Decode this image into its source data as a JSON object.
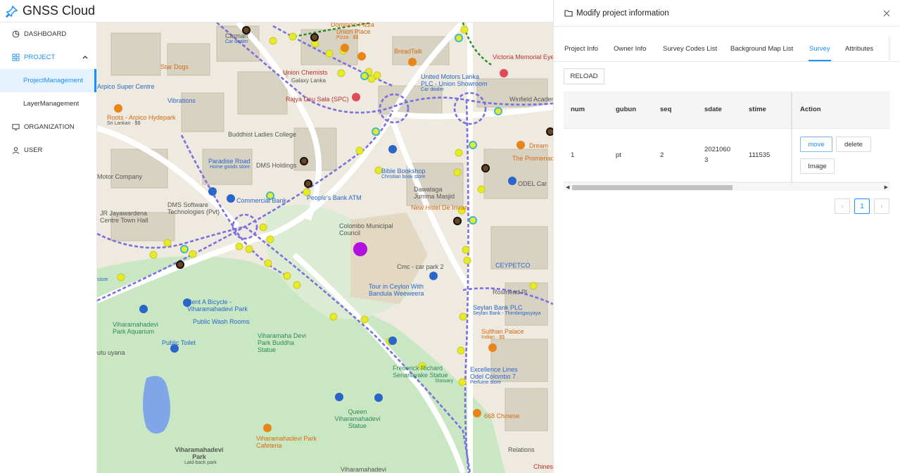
{
  "app": {
    "title": "GNSS Cloud"
  },
  "sidebar": {
    "items": [
      {
        "label": "DASHBOARD",
        "icon": "dashboard-icon"
      },
      {
        "label": "PROJECT",
        "icon": "project-icon"
      },
      {
        "label": "ProjectManagement"
      },
      {
        "label": "LayerManagement"
      },
      {
        "label": "ORGANIZATION",
        "icon": "monitor-icon"
      },
      {
        "label": "USER",
        "icon": "user-icon"
      }
    ]
  },
  "map": {
    "labels": [
      "Carmart",
      "Car dealer",
      "Domino's Pizza",
      "Union Place",
      "Pizza · $$",
      "BreadTalk",
      "Victoria Memorial Eye Hospital",
      "Star Dogs",
      "Union Chemists",
      "Galaxy Lanka",
      "United Motors Lanka PLC - Union Showroom",
      "Car dealer",
      "Arpico Super Centre",
      "Vibrations",
      "Rajya Osu Sala (SPC)",
      "Winfield Academy",
      "Roots - Arpico Hydepark",
      "Sri Lankan · $$",
      "Buddhist Ladies College",
      "Dream",
      "Paradise Road",
      "Home goods store",
      "DMS Holdings",
      "Bible Bookshop",
      "Christian book store",
      "The Promenade",
      "Motor Company",
      "DMS Software Technologies (Pvt)",
      "Commercial Bank",
      "People's Bank ATM",
      "Dawataga Jumma Masjid",
      "New Hotel De Imran",
      "ODEL Car",
      "JR Jayawardena Centre Town Hall",
      "Colombo Municipal Council",
      "Cmc - car park 2",
      "CEYPETCO",
      "Tour in Ceylon With Bandula Weeweera",
      "Rosmead Pl",
      "Seylan Bank PLC",
      "Seylan Bank - Thimbirigasyaya",
      "Rent A Bicycle - Viharamahadevi Park",
      "Viharamahadevi Park Aquarium",
      "Public Wash Rooms",
      "Viharamaha Devi Park Buddha Statue",
      "Sulthan Palace",
      "Indian · $$",
      "Public Toilet",
      "Frederick Richard Senanayake Statue",
      "Statuary",
      "Excellence Lines",
      "Odel Colombo 7",
      "Perfume store",
      "668 Chinese",
      "Queen Viharamahadevi Statue",
      "Viharamahadevi Park Cafeteria",
      "Viharamahadevi Park",
      "Laid-back park",
      "Relations",
      "Chinese",
      "Viharamahadevi",
      "utu uyana",
      "store"
    ]
  },
  "panel": {
    "title": "Modify project information",
    "tabs": [
      "Project Info",
      "Owner Info",
      "Survey Codes List",
      "Background Map List",
      "Survey",
      "Attributes"
    ],
    "active_tab": "Survey",
    "reload_label": "RELOAD",
    "table": {
      "columns": [
        "num",
        "gubun",
        "seq",
        "sdate",
        "stime"
      ],
      "action_header": "Action",
      "rows": [
        {
          "num": "1",
          "gubun": "pt",
          "seq": "2",
          "sdate_line1": "2021060",
          "sdate_line2": "3",
          "stime": "111535"
        }
      ],
      "move_label": "move",
      "delete_label": "delete",
      "image_label": "Image"
    },
    "pagination": {
      "prev": "‹",
      "current": "1",
      "next": "›"
    }
  }
}
